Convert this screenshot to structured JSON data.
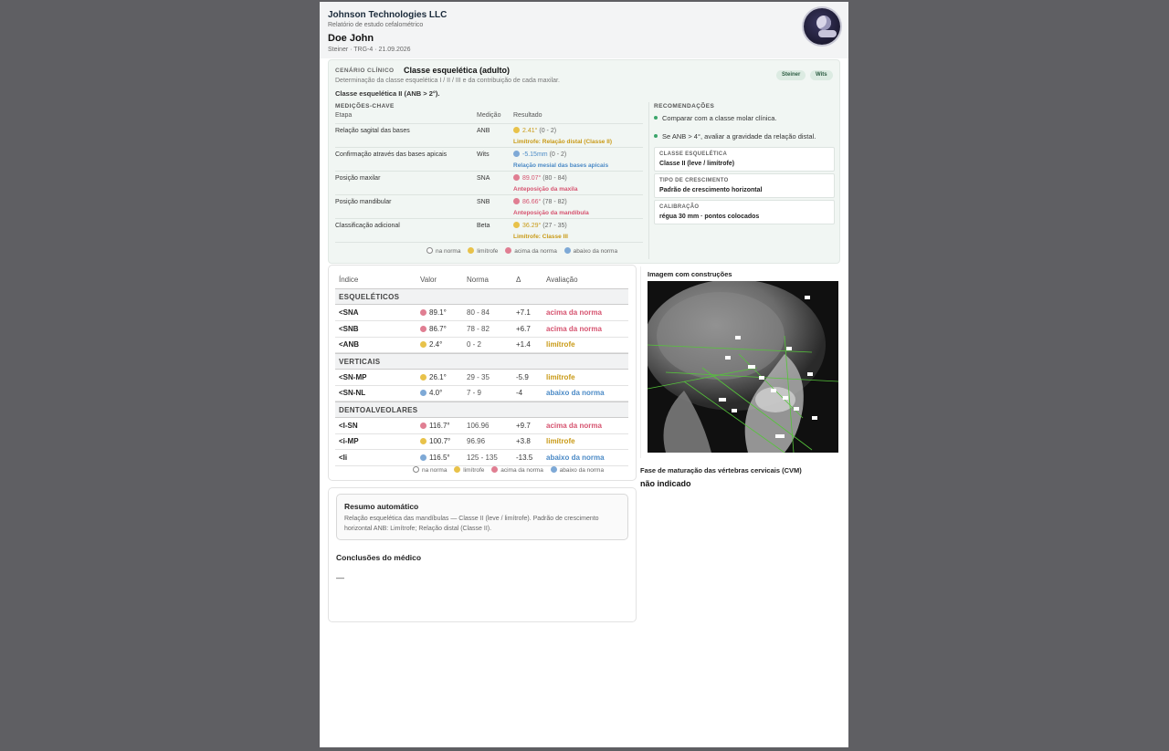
{
  "header": {
    "company": "Johnson Technologies LLC",
    "subtitle": "Relatório de estudo cefalométrico",
    "patient": "Doe John",
    "meta": "Steiner · TRG-4 · 21.09.2026"
  },
  "clinical": {
    "label": "CENÁRIO CLÍNICO",
    "title": "Classe esquelética (adulto)",
    "description": "Determinação da classe esquelética I / II / III e da contribuição de cada maxilar.",
    "result": "Classe esquelética II (ANB > 2°).",
    "chips": [
      "Steiner",
      "Wits"
    ],
    "measures_label": "MEDIÇÕES-CHAVE",
    "columns": [
      "Etapa",
      "Medição",
      "Resultado"
    ],
    "measures": [
      {
        "step": "Relação sagital das bases",
        "measure": "ANB",
        "value": "2.41°",
        "range": "(0 - 2)",
        "note": "Limítrofe: Relação distal (Classe II)",
        "status": "y"
      },
      {
        "step": "Confirmação através das bases apicais",
        "measure": "Wits",
        "value": "-5.15mm",
        "range": "(0 - 2)",
        "note": "Relação mesial das bases apicais",
        "status": "b"
      },
      {
        "step": "Posição maxilar",
        "measure": "SNA",
        "value": "89.07°",
        "range": "(80 - 84)",
        "note": "Anteposição da maxila",
        "status": "r"
      },
      {
        "step": "Posição mandibular",
        "measure": "SNB",
        "value": "86.66°",
        "range": "(78 - 82)",
        "note": "Anteposição da mandíbula",
        "status": "r"
      },
      {
        "step": "Classificação adicional",
        "measure": "Beta",
        "value": "36.29°",
        "range": "(27 - 35)",
        "note": "Limítrofe: Classe III",
        "status": "y"
      }
    ],
    "recs_label": "RECOMENDAÇÕES",
    "recs": [
      "Comparar com a classe molar clínica.",
      "Se ANB > 4°, avaliar a gravidade da relação distal."
    ],
    "boxes": [
      {
        "label": "CLASSE ESQUELÉTICA",
        "value": "Classe II (leve / limítrofe)"
      },
      {
        "label": "TIPO DE CRESCIMENTO",
        "value": "Padrão de crescimento horizontal"
      },
      {
        "label": "CALIBRAÇÃO",
        "value": "régua 30 mm · pontos colocados"
      }
    ]
  },
  "legend": {
    "in": "na norma",
    "border": "limítrofe",
    "above": "acima da norma",
    "below": "abaixo da norma"
  },
  "indices": {
    "columns": [
      "Índice",
      "Valor",
      "Norma",
      "Δ",
      "Avaliação"
    ],
    "sections": [
      {
        "title": "ESQUELÉTICOS",
        "rows": [
          {
            "name": "<SNA",
            "value": "89.1°",
            "norm": "80 - 84",
            "delta": "+7.1",
            "eval": "acima da norma",
            "status": "r"
          },
          {
            "name": "<SNB",
            "value": "86.7°",
            "norm": "78 - 82",
            "delta": "+6.7",
            "eval": "acima da norma",
            "status": "r"
          },
          {
            "name": "<ANB",
            "value": "2.4°",
            "norm": "0 - 2",
            "delta": "+1.4",
            "eval": "limítrofe",
            "status": "y"
          }
        ]
      },
      {
        "title": "VERTICAIS",
        "rows": [
          {
            "name": "<SN-MP",
            "value": "26.1°",
            "norm": "29 - 35",
            "delta": "-5.9",
            "eval": "limítrofe",
            "status": "y"
          },
          {
            "name": "<SN-NL",
            "value": "4.0°",
            "norm": "7 - 9",
            "delta": "-4",
            "eval": "abaixo da norma",
            "status": "b"
          }
        ]
      },
      {
        "title": "DENTOALVEOLARES",
        "rows": [
          {
            "name": "<I-SN",
            "value": "116.7°",
            "norm": "106.96",
            "delta": "+9.7",
            "eval": "acima da norma",
            "status": "r"
          },
          {
            "name": "<i-MP",
            "value": "100.7°",
            "norm": "96.96",
            "delta": "+3.8",
            "eval": "limítrofe",
            "status": "y"
          },
          {
            "name": "<Ii",
            "value": "116.5°",
            "norm": "125 - 135",
            "delta": "-13.5",
            "eval": "abaixo da norma",
            "status": "b"
          }
        ]
      }
    ]
  },
  "image": {
    "title": "Imagem com construções"
  },
  "cvm": {
    "title": "Fase de maturação das vértebras cervicais (CVM)",
    "value": "não indicado"
  },
  "summary": {
    "title": "Resumo automático",
    "text": "Relação esquelética das mandíbulas — Classe II (leve / limítrofe). Padrão de crescimento horizontal ANB: Limítrofe; Relação distal (Classe II).",
    "conclusions_title": "Conclusões do médico",
    "conclusions": "—"
  },
  "colors": {
    "border": "#e8c24a",
    "above": "#e07e92",
    "below": "#7ea9d6",
    "accent": "#3aa56a"
  }
}
